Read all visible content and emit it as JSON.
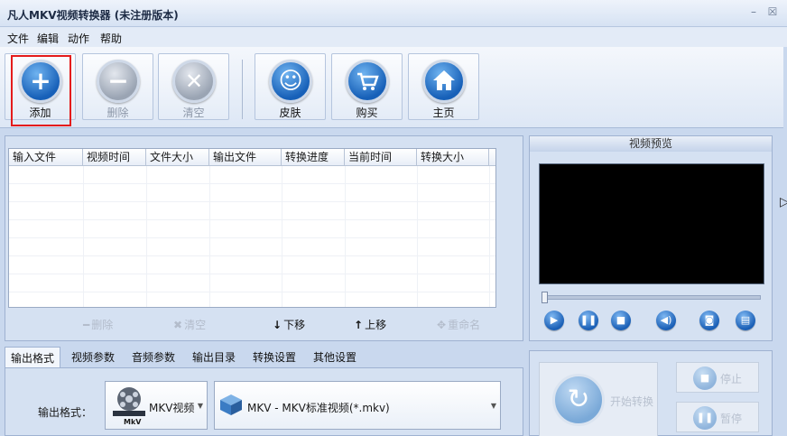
{
  "window": {
    "title": "凡人MKV视频转换器  (未注册版本)",
    "minimize": "–",
    "close": "☒"
  },
  "menu": [
    "文件",
    "编辑",
    "动作",
    "帮助"
  ],
  "toolbar": {
    "add": "添加",
    "delete": "删除",
    "clear": "清空",
    "skin": "皮肤",
    "buy": "购买",
    "home": "主页"
  },
  "table": {
    "columns": [
      "输入文件",
      "视频时间",
      "文件大小",
      "输出文件",
      "转换进度",
      "当前时间",
      "转换大小"
    ]
  },
  "list_actions": {
    "delete": "删除",
    "clear": "清空",
    "down": "下移",
    "up": "上移",
    "rename": "重命名"
  },
  "preview": {
    "title": "视频预览"
  },
  "tabs": [
    "输出格式",
    "视频参数",
    "音频参数",
    "输出目录",
    "转换设置",
    "其他设置"
  ],
  "output": {
    "label": "输出格式：",
    "format_category": "MKV视频",
    "icon_caption": "MkV",
    "format_profile": "MKV - MKV标准视频(*.mkv)"
  },
  "convert": {
    "start": "开始转换",
    "stop": "停止",
    "pause": "暂停"
  },
  "colors": {
    "accent": "#1760b8",
    "highlight": "#e41b1b"
  }
}
